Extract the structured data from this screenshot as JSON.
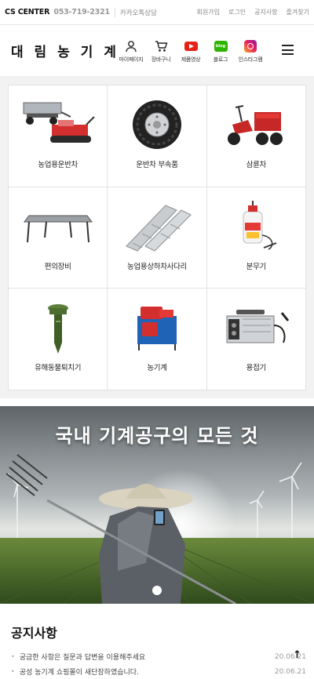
{
  "topbar": {
    "cs_label": "CS CENTER",
    "phone": "053-719-2321",
    "kakao": "카카오톡상담",
    "links": [
      "회원가입",
      "로그인",
      "공지사항",
      "즐겨찾기"
    ]
  },
  "header": {
    "logo": "대 림 농 기 계",
    "icons": [
      {
        "label": "마이페이지",
        "icon": "person-icon"
      },
      {
        "label": "장바구니",
        "icon": "cart-icon"
      },
      {
        "label": "제품영상",
        "icon": "youtube-icon"
      },
      {
        "label": "블로그",
        "icon": "blog-icon",
        "badge": "blog"
      },
      {
        "label": "인스타그램",
        "icon": "instagram-icon"
      }
    ],
    "menu_icon": "hamburger-icon"
  },
  "categories": [
    {
      "label": "농업용운반차",
      "icon": "transport-cart-icon"
    },
    {
      "label": "운반차 부속품",
      "icon": "tire-wheel-icon"
    },
    {
      "label": "삼륜차",
      "icon": "tricycle-icon"
    },
    {
      "label": "편의장비",
      "icon": "work-table-icon"
    },
    {
      "label": "농업용상하차사다리",
      "icon": "loading-ramp-icon"
    },
    {
      "label": "분무기",
      "icon": "sprayer-icon"
    },
    {
      "label": "유해동물퇴치기",
      "icon": "pest-repeller-icon"
    },
    {
      "label": "농기계",
      "icon": "farm-machine-icon"
    },
    {
      "label": "용접기",
      "icon": "welder-icon"
    }
  ],
  "banner": {
    "title": "국내 기계공구의 모든 것",
    "slide_count": 1
  },
  "notice": {
    "title": "공지사항",
    "items": [
      {
        "text": "궁금한 사항은 질문과 답변을 이용해주세요",
        "date": "20.06.21"
      },
      {
        "text": "공성 농기계 쇼핑몰이 새단장하였습니다.",
        "date": "20.06.21"
      }
    ],
    "top_button": "↑"
  },
  "colors": {
    "youtube": "#e62117",
    "blog": "#2db400",
    "accent_red": "#d32f2f"
  }
}
